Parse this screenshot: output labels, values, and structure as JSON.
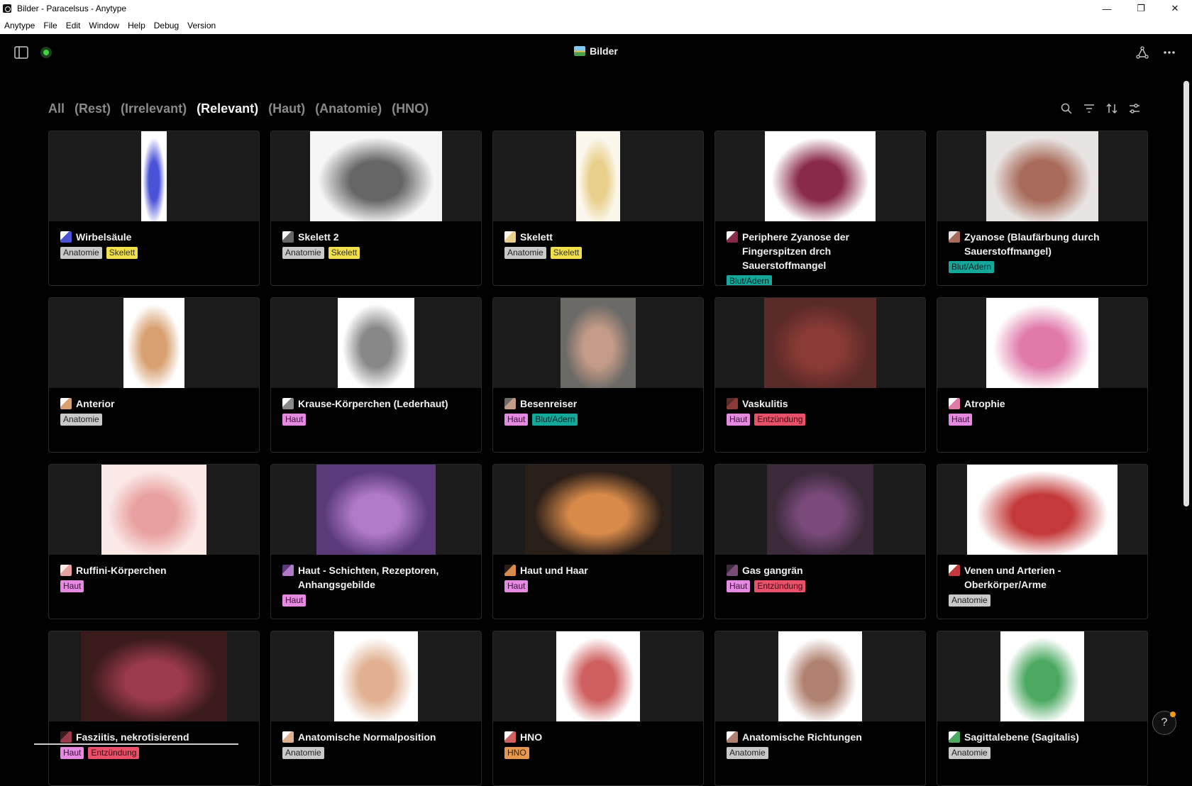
{
  "window": {
    "title": "Bilder - Paracelsus - Anytype"
  },
  "menu": [
    "Anytype",
    "File",
    "Edit",
    "Window",
    "Help",
    "Debug",
    "Version"
  ],
  "header": {
    "title": "Bilder"
  },
  "tabs": [
    "All",
    "(Rest)",
    "(Irrelevant)",
    "(Relevant)",
    "(Haut)",
    "(Anatomie)",
    "(HNO)"
  ],
  "active_tab_index": 3,
  "tag_colors": {
    "Anatomie": "#c9c9c9",
    "Skelett": "#f2e04b",
    "Blut/Adern": "#14a89a",
    "Haut": "#e58ae0",
    "Entzündung": "#e9516a",
    "HNO": "#e6984e"
  },
  "cards": [
    {
      "title": "Wirbelsäule",
      "tags": [
        "Anatomie",
        "Skelett"
      ],
      "cover_bg": "#ffffff",
      "cover_w": 36,
      "accent": "#4a52d8"
    },
    {
      "title": "Skelett 2",
      "tags": [
        "Anatomie",
        "Skelett"
      ],
      "cover_bg": "#f6f6f6",
      "cover_w": 186,
      "accent": "#666666"
    },
    {
      "title": "Skelett",
      "tags": [
        "Anatomie",
        "Skelett"
      ],
      "cover_bg": "#fbf7ec",
      "cover_w": 62,
      "accent": "#e8cf8a"
    },
    {
      "title": "Periphere Zyanose der Fingerspitzen drch Sauerstoffmangel",
      "tags": [
        "Blut/Adern"
      ],
      "cover_bg": "#ffffff",
      "cover_w": 156,
      "accent": "#8a2a4a"
    },
    {
      "title": "Zyanose (Blaufärbung durch Sauerstoffmangel)",
      "tags": [
        "Blut/Adern"
      ],
      "cover_bg": "#e8e4e2",
      "cover_w": 158,
      "accent": "#a86a5a"
    },
    {
      "title": "Anterior",
      "tags": [
        "Anatomie"
      ],
      "cover_bg": "#ffffff",
      "cover_w": 86,
      "accent": "#d8a070"
    },
    {
      "title": "Krause-Körperchen (Lederhaut)",
      "tags": [
        "Haut"
      ],
      "cover_bg": "#ffffff",
      "cover_w": 108,
      "accent": "#888888"
    },
    {
      "title": "Besenreiser",
      "tags": [
        "Haut",
        "Blut/Adern"
      ],
      "cover_bg": "#6c6a66",
      "cover_w": 106,
      "accent": "#c49a88"
    },
    {
      "title": "Vaskulitis",
      "tags": [
        "Haut",
        "Entzündung"
      ],
      "cover_bg": "#5a2a28",
      "cover_w": 158,
      "accent": "#8a3a34"
    },
    {
      "title": "Atrophie",
      "tags": [
        "Haut"
      ],
      "cover_bg": "#ffffff",
      "cover_w": 158,
      "accent": "#e07aa8"
    },
    {
      "title": "Ruffini-Körperchen",
      "tags": [
        "Haut"
      ],
      "cover_bg": "#fbe9e6",
      "cover_w": 148,
      "accent": "#e8a0a0"
    },
    {
      "title": "Haut - Schichten, Rezeptoren, Anhangsgebilde",
      "tags": [
        "Haut"
      ],
      "cover_bg": "#5a3a7a",
      "cover_w": 168,
      "accent": "#b07ac8"
    },
    {
      "title": "Haut und Haar",
      "tags": [
        "Haut"
      ],
      "cover_bg": "#2a1e18",
      "cover_w": 206,
      "accent": "#d88a4a"
    },
    {
      "title": "Gas gangrän",
      "tags": [
        "Haut",
        "Entzündung"
      ],
      "cover_bg": "#3a2a3a",
      "cover_w": 150,
      "accent": "#7a4a7a"
    },
    {
      "title": "Venen und Arterien - Oberkörper/Arme",
      "tags": [
        "Anatomie"
      ],
      "cover_bg": "#ffffff",
      "cover_w": 212,
      "accent": "#c43a3a"
    },
    {
      "title": "Fasziitis, nekrotisierend",
      "tags": [
        "Haut",
        "Entzündung"
      ],
      "cover_bg": "#3a1a1a",
      "cover_w": 206,
      "accent": "#9a3a4a"
    },
    {
      "title": "Anatomische Normalposition",
      "tags": [
        "Anatomie"
      ],
      "cover_bg": "#ffffff",
      "cover_w": 118,
      "accent": "#e0b090"
    },
    {
      "title": "HNO",
      "tags": [
        "HNO"
      ],
      "cover_bg": "#ffffff",
      "cover_w": 118,
      "accent": "#d06060"
    },
    {
      "title": "Anatomische Richtungen",
      "tags": [
        "Anatomie"
      ],
      "cover_bg": "#ffffff",
      "cover_w": 118,
      "accent": "#b08070"
    },
    {
      "title": "Sagittalebene (Sagitalis)",
      "tags": [
        "Anatomie"
      ],
      "cover_bg": "#ffffff",
      "cover_w": 118,
      "accent": "#4aa860"
    }
  ]
}
